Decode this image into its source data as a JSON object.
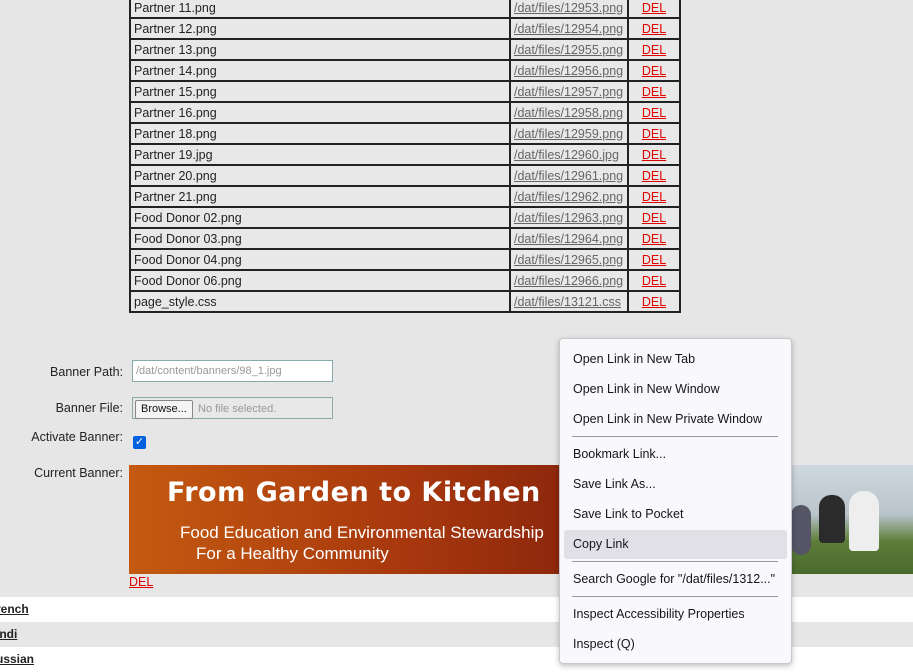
{
  "files": [
    {
      "name": "Partner 11.png",
      "path": "/dat/files/12953.png",
      "del": "DEL"
    },
    {
      "name": "Partner 12.png",
      "path": "/dat/files/12954.png",
      "del": "DEL"
    },
    {
      "name": "Partner 13.png",
      "path": "/dat/files/12955.png",
      "del": "DEL"
    },
    {
      "name": "Partner 14.png",
      "path": "/dat/files/12956.png",
      "del": "DEL"
    },
    {
      "name": "Partner 15.png",
      "path": "/dat/files/12957.png",
      "del": "DEL"
    },
    {
      "name": "Partner 16.png",
      "path": "/dat/files/12958.png",
      "del": "DEL"
    },
    {
      "name": "Partner 18.png",
      "path": "/dat/files/12959.png",
      "del": "DEL"
    },
    {
      "name": "Partner 19.jpg",
      "path": "/dat/files/12960.jpg",
      "del": "DEL"
    },
    {
      "name": "Partner 20.png",
      "path": "/dat/files/12961.png",
      "del": "DEL"
    },
    {
      "name": "Partner 21.png",
      "path": "/dat/files/12962.png",
      "del": "DEL"
    },
    {
      "name": "Food Donor 02.png",
      "path": "/dat/files/12963.png",
      "del": "DEL"
    },
    {
      "name": "Food Donor 03.png",
      "path": "/dat/files/12964.png",
      "del": "DEL"
    },
    {
      "name": "Food Donor 04.png",
      "path": "/dat/files/12965.png",
      "del": "DEL"
    },
    {
      "name": "Food Donor 06.png",
      "path": "/dat/files/12966.png",
      "del": "DEL"
    },
    {
      "name": "page_style.css",
      "path": "/dat/files/13121.css",
      "del": "DEL"
    }
  ],
  "form": {
    "banner_path_label": "Banner Path:",
    "banner_path_placeholder": "/dat/content/banners/98_1.jpg",
    "banner_file_label": "Banner File:",
    "browse_label": "Browse...",
    "no_file": "No file selected.",
    "activate_label": "Activate Banner:",
    "activate_checked": true,
    "current_banner_label": "Current Banner:",
    "banner_del": "DEL"
  },
  "banner": {
    "title": "From Garden to Kitchen",
    "line1": "Food Education and Environmental Stewardship",
    "line2": "For a Healthy Community"
  },
  "languages": [
    "rench",
    "indi",
    "ussian"
  ],
  "context_menu": {
    "items": [
      {
        "label": "Open Link in New Tab"
      },
      {
        "label": "Open Link in New Window"
      },
      {
        "label": "Open Link in New Private Window"
      },
      {
        "label": "Bookmark Link..."
      },
      {
        "label": "Save Link As..."
      },
      {
        "label": "Save Link to Pocket"
      },
      {
        "label": "Copy Link"
      },
      {
        "label": "Search Google for \"/dat/files/1312...\""
      },
      {
        "label": "Inspect Accessibility Properties"
      },
      {
        "label": "Inspect (Q)"
      }
    ]
  },
  "colors": {
    "link_del": "#e00000",
    "checkbox": "#0060df",
    "menu_hover": "#e0e0e6"
  }
}
